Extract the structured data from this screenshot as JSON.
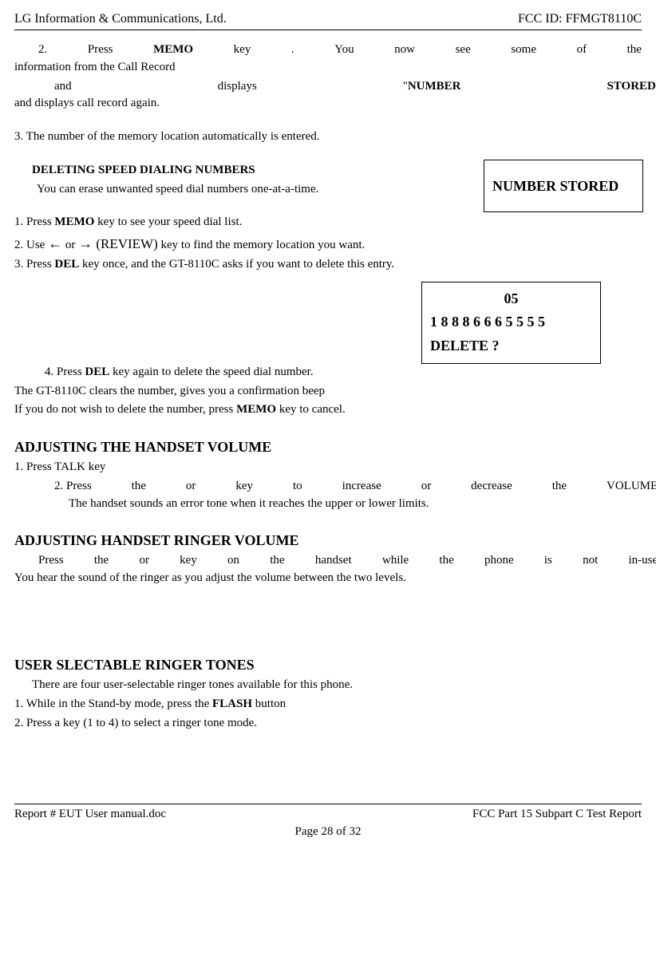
{
  "header": {
    "left": "LG Information & Communications, Ltd.",
    "right": "FCC ID: FFMGT8110C"
  },
  "footer": {
    "left": "Report # EUT User manual.doc",
    "right": "FCC Part 15 Subpart C Test Report",
    "page": "Page 28 of 32"
  },
  "body": {
    "line2_a": "2.",
    "line2_b": "Press",
    "line2_c": "MEMO",
    "line2_d": "key",
    "line2_e": ".",
    "line2_f": "You",
    "line2_g": "now",
    "line2_h": "see",
    "line2_i": "some",
    "line2_j": "of",
    "line2_k": "the",
    "line3": "information from the Call Record",
    "line4_a": "and",
    "line4_b": "displays",
    "line4_c": "\"",
    "line4_d": "NUMBER",
    "line4_e": "STORED",
    "line4_f": "\"",
    "line5": "and displays call record again.",
    "line6": "3. The number of the memory location automatically is entered.",
    "box1": "NUMBER STORED",
    "h_del": "DELETING SPEED DIALING NUMBERS",
    "del_p": "You can erase unwanted speed dial numbers one-at-a-time.",
    "del_1a": "1.  Press ",
    "del_1b": "MEMO",
    "del_1c": " key to see your speed dial list.",
    "del_2a": "2.  Use  ",
    "del_2b": "←",
    "del_2c": "  or  ",
    "del_2d": "→",
    "del_2e": " (REVIEW)",
    "del_2f": " key to find the memory location you want.",
    "del_3a": "3.  Press ",
    "del_3b": "DEL",
    "del_3c": " key once, and the GT-8110C asks if you want to delete this entry.",
    "box2_l1": "05",
    "box2_l2": "1 8 8 8 6 6 6 5 5 5 5",
    "box2_l3": "DELETE ?",
    "del_4a": "4.  Press ",
    "del_4b": "DEL",
    "del_4c": " key again to delete the speed dial number.",
    "del_5": "The GT-8110C clears the number, gives you a confirmation beep",
    "del_6a": "If you do not wish to delete the number, press ",
    "del_6b": "MEMO",
    "del_6c": " key to cancel.",
    "h_vol": "ADJUSTING THE HANDSET VOLUME",
    "vol_1": "1. Press TALK key",
    "vol_2_a": "2. Press",
    "vol_2_b": "the",
    "vol_2_c": "or",
    "vol_2_d": "key",
    "vol_2_e": "to",
    "vol_2_f": "increase",
    "vol_2_g": "or",
    "vol_2_h": "decrease",
    "vol_2_i": "the",
    "vol_2_j": "VOLUME.",
    "vol_3": "The handset sounds an error tone when it reaches the upper or lower limits.",
    "h_ring": "ADJUSTING HANDSET RINGER VOLUME",
    "ring_1_a": "Press",
    "ring_1_b": "the",
    "ring_1_c": "or",
    "ring_1_d": "key",
    "ring_1_e": "on",
    "ring_1_f": "the",
    "ring_1_g": "handset",
    "ring_1_h": "while",
    "ring_1_i": "the",
    "ring_1_j": "phone",
    "ring_1_k": "is",
    "ring_1_l": "not",
    "ring_1_m": "in-use.",
    "ring_2": "You hear the sound of the ringer as you adjust the volume between the two levels.",
    "h_tones": "USER SLECTABLE RINGER TONES",
    "tones_p": "There are four user-selectable ringer tones available for this phone.",
    "tones_1a": "1. While in the Stand-by mode, press the ",
    "tones_1b": "FLASH",
    "tones_1c": " button",
    "tones_2": "2. Press a key (1 to 4) to select a ringer tone mode."
  }
}
